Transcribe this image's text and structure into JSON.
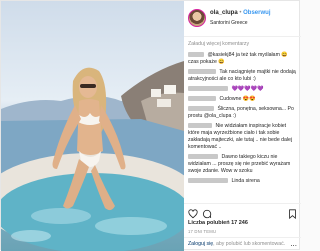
{
  "header": {
    "username": "ola_clupa",
    "separator": "•",
    "follow_label": "Obserwuj",
    "location": "Santorini Greece"
  },
  "comments": {
    "load_more": "Załaduj więcej komentarzy",
    "items": [
      {
        "text": "@kasiekj84 ja też tak myślałam 😄 czas pokaże 😄"
      },
      {
        "text": "Tak naciągnięte majtki nie dodają atrakcyjności ale co kto lubi :)"
      },
      {
        "text": "💜💜💜💜💜"
      },
      {
        "text": "Cudowne 😍😍"
      },
      {
        "text": "Śliczna, ponętna, seksowna... Po prostu @ola_clupa :)"
      },
      {
        "text": "Nie widziałam inspiracje kobiet które maja wyrzeźbione ciało i tak sobie zakładają majteczki, ale tutaj .. nie bede dalej komentować .."
      },
      {
        "text": "Dawno takiego kiczu nie widziałam ... proszę się nie przebić wyrażam swoje zdanie. Wow w szoku"
      },
      {
        "text": "Linda sirena"
      }
    ]
  },
  "stats": {
    "likes": "Liczba polubień 17 246",
    "time": "17 DNI TEMU"
  },
  "comment_box": {
    "login_link": "Zaloguj się",
    "login_rest": ", aby polubić lub skomentować.",
    "more_label": "..."
  },
  "icons": {
    "like": "heart-icon",
    "comment": "comment-icon",
    "save": "bookmark-icon",
    "more": "more-icon"
  }
}
